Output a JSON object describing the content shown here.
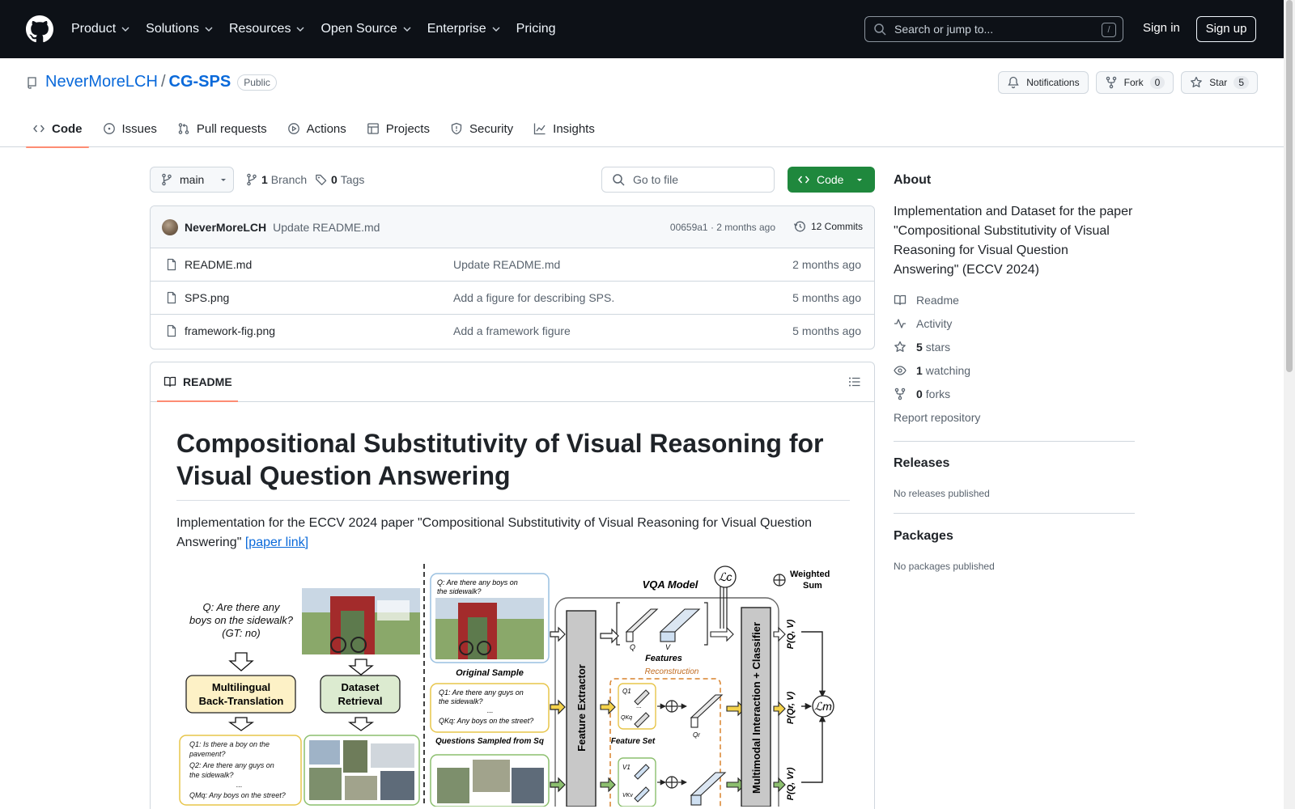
{
  "header": {
    "nav": [
      {
        "label": "Product",
        "has_menu": true
      },
      {
        "label": "Solutions",
        "has_menu": true
      },
      {
        "label": "Resources",
        "has_menu": true
      },
      {
        "label": "Open Source",
        "has_menu": true
      },
      {
        "label": "Enterprise",
        "has_menu": true
      },
      {
        "label": "Pricing",
        "has_menu": false
      }
    ],
    "search_placeholder": "Search or jump to...",
    "search_shortcut": "/",
    "sign_in": "Sign in",
    "sign_up": "Sign up"
  },
  "repo": {
    "owner": "NeverMoreLCH",
    "separator": "/",
    "name": "CG-SPS",
    "visibility": "Public",
    "notifications_label": "Notifications",
    "fork_label": "Fork",
    "fork_count": "0",
    "star_label": "Star",
    "star_count": "5"
  },
  "tabs": [
    {
      "label": "Code",
      "icon": "code-icon",
      "active": true
    },
    {
      "label": "Issues",
      "icon": "issue-icon",
      "active": false
    },
    {
      "label": "Pull requests",
      "icon": "pull-request-icon",
      "active": false
    },
    {
      "label": "Actions",
      "icon": "play-icon",
      "active": false
    },
    {
      "label": "Projects",
      "icon": "table-icon",
      "active": false
    },
    {
      "label": "Security",
      "icon": "shield-icon",
      "active": false
    },
    {
      "label": "Insights",
      "icon": "graph-icon",
      "active": false
    }
  ],
  "toolbar": {
    "branch": "main",
    "branch_count": "1",
    "branch_label": "Branch",
    "tag_count": "0",
    "tag_label": "Tags",
    "go_to_file": "Go to file",
    "code_button": "Code"
  },
  "commit": {
    "author": "NeverMoreLCH",
    "message": "Update README.md",
    "meta": "00659a1 · 2 months ago",
    "count_label": "12 Commits"
  },
  "files": [
    {
      "name": "README.md",
      "message": "Update README.md",
      "date": "2 months ago"
    },
    {
      "name": "SPS.png",
      "message": "Add a figure for describing SPS.",
      "date": "5 months ago"
    },
    {
      "name": "framework-fig.png",
      "message": "Add a framework figure",
      "date": "5 months ago"
    }
  ],
  "readme": {
    "tab_label": "README",
    "title": "Compositional Substitutivity of Visual Reasoning for Visual Question Answering",
    "intro": "Implementation for the ECCV 2024 paper \"Compositional Substitutivity of Visual Reasoning for Visual Question Answering\"",
    "link_text": "[paper link]",
    "figure": {
      "q_main": "Q: Are there any boys on the sidewalk? (GT: no)",
      "q_line1": "Q: Are there any",
      "q_line2": "boys on the sidewalk?",
      "q_line3": "(GT: no)",
      "box_mbt_1": "Multilingual",
      "box_mbt_2": "Back-Translation",
      "box_dr_1": "Dataset",
      "box_dr_2": "Retrieval",
      "qs_1": "Q1: Is there a boy on the",
      "qs_2": "pavement?",
      "qs_3": "Q2: Are there any guys on",
      "qs_4": "the sidewalk?",
      "qs_5": "...",
      "qs_6": "QMq: Any boys on the street?",
      "orig_q1": "Q: Are there any boys on",
      "orig_q2": "the sidewalk?",
      "original_sample": "Original Sample",
      "sq_1": "Q1: Are there any guys on",
      "sq_2": "the sidewalk?",
      "sq_3": "...",
      "sq_4": "QKq: Any boys on the street?",
      "questions_sampled": "Questions Sampled from Sq",
      "vqa_model": "VQA Model",
      "features": "Features",
      "q_label": "Q",
      "v_label": "V",
      "feature_extractor": "Feature Extractor",
      "reconstruction": "Reconstruction",
      "feature_set": "Feature Set",
      "q1_label": "Q1",
      "qkq_label": "QKq",
      "qr_label": "Qr",
      "v1_label": "V1",
      "vkv_label": "VKv",
      "dots": "...",
      "multimodal": "Multimodal Interaction + Classifier",
      "p_qv": "P(Q, V)",
      "p_qrv": "P(Qr, V)",
      "p_qvr": "P(Q, Vr)",
      "loss_c": "ℒc",
      "loss_m": "ℒm",
      "weighted_1": "Weighted",
      "weighted_2": "Sum"
    }
  },
  "about": {
    "heading": "About",
    "description": "Implementation and Dataset for the paper \"Compositional Substitutivity of Visual Reasoning for Visual Question Answering\" (ECCV 2024)",
    "readme": "Readme",
    "activity": "Activity",
    "stars_count": "5",
    "stars_label": "stars",
    "watching_count": "1",
    "watching_label": "watching",
    "forks_count": "0",
    "forks_label": "forks",
    "report": "Report repository"
  },
  "releases": {
    "heading": "Releases",
    "empty": "No releases published"
  },
  "packages": {
    "heading": "Packages",
    "empty": "No packages published"
  },
  "colors": {
    "header_bg": "#0d1117",
    "link": "#0969da",
    "code_button": "#1f883d",
    "active_tab_underline": "#fd8c73"
  }
}
